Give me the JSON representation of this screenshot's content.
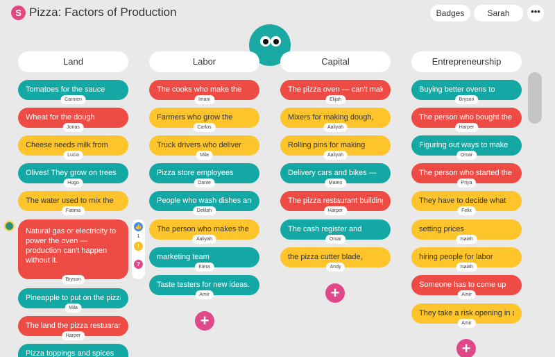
{
  "app": {
    "logo_letter": "S",
    "title": "Pizza: Factors of Production"
  },
  "header": {
    "badges_label": "Badges",
    "user_label": "Sarah",
    "more_label": "•••"
  },
  "columns": [
    {
      "title": "Land",
      "cards": [
        {
          "text": "Tomatoes for the sauce",
          "author": "Carmen",
          "color": "teal"
        },
        {
          "text": "Wheat for the dough",
          "author": "Jonas",
          "color": "red"
        },
        {
          "text": "Cheese needs milk from",
          "author": "Lucia",
          "color": "yellow"
        },
        {
          "text": "Olives! They grow on trees",
          "author": "Hugo",
          "color": "teal"
        },
        {
          "text": "The water used to mix the",
          "author": "Fatima",
          "color": "yellow"
        },
        {
          "text": "Natural gas or electricity to power the oven — production can't happen without it.",
          "author": "Bryson",
          "color": "red"
        },
        {
          "text": "Pineapple to put on the pizza",
          "author": "Mila",
          "color": "teal"
        },
        {
          "text": "The land the pizza restuarant",
          "author": "Harper",
          "color": "red"
        },
        {
          "text": "Pizza toppings and spices",
          "author": "",
          "color": "teal"
        }
      ]
    },
    {
      "title": "Labor",
      "cards": [
        {
          "text": "The cooks who make the",
          "author": "Imani",
          "color": "red"
        },
        {
          "text": "Farmers who grow the",
          "author": "Carlos",
          "color": "yellow"
        },
        {
          "text": "Truck drivers who deliver",
          "author": "Mila",
          "color": "yellow"
        },
        {
          "text": "Pizza store employees",
          "author": "Dante",
          "color": "teal"
        },
        {
          "text": "People who wash dishes and",
          "author": "Delilah",
          "color": "teal"
        },
        {
          "text": "The person who makes the",
          "author": "Aaliyah",
          "color": "yellow"
        },
        {
          "text": "marketing team",
          "author": "Kiera",
          "color": "teal"
        },
        {
          "text": "Taste testers for new ideas. I",
          "author": "Amir",
          "color": "teal"
        }
      ]
    },
    {
      "title": "Capital",
      "cards": [
        {
          "text": "The pizza oven — can't make",
          "author": "Elijah",
          "color": "red"
        },
        {
          "text": "Mixers for making dough,",
          "author": "Aaliyah",
          "color": "yellow"
        },
        {
          "text": "Rolling pins for making",
          "author": "Aaliyah",
          "color": "yellow"
        },
        {
          "text": "Delivery cars and bikes —",
          "author": "Mateo",
          "color": "teal"
        },
        {
          "text": "The pizza restaurant building",
          "author": "Harper",
          "color": "red"
        },
        {
          "text": "The cash register and",
          "author": "Omar",
          "color": "teal"
        },
        {
          "text": "the pizza cutter blade,",
          "author": "Andy",
          "color": "yellow"
        }
      ]
    },
    {
      "title": "Entrepreneurship",
      "cards": [
        {
          "text": "Buying better ovens to",
          "author": "Bryson",
          "color": "teal"
        },
        {
          "text": "The person who bought the",
          "author": "Harper",
          "color": "red"
        },
        {
          "text": "Figuring out ways to make",
          "author": "Omar",
          "color": "teal"
        },
        {
          "text": "The person who started the",
          "author": "Priya",
          "color": "red"
        },
        {
          "text": "They have to decide what",
          "author": "Felix",
          "color": "yellow"
        },
        {
          "text": "setting prices",
          "author": "Isaiah",
          "color": "yellow"
        },
        {
          "text": "hiring people for labor",
          "author": "Isaiah",
          "color": "yellow"
        },
        {
          "text": "Someone has to come up",
          "author": "Amir",
          "color": "red"
        },
        {
          "text": "They take a risk opening in a",
          "author": "Amir",
          "color": "yellow"
        }
      ]
    }
  ],
  "add_label": "+",
  "reactions": {
    "like_count": "1"
  }
}
